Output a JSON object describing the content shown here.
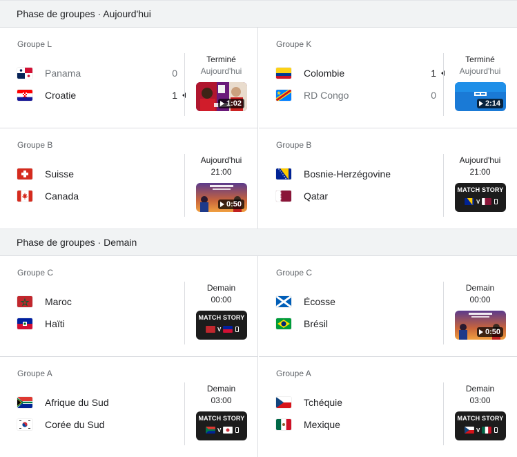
{
  "sections": [
    {
      "title": "Phase de groupes · Aujourd'hui"
    },
    {
      "title": "Phase de groupes · Demain"
    }
  ],
  "matches": [
    {
      "group": "Groupe L",
      "status_line1": "Terminé",
      "status_line2": "Aujourd'hui",
      "team1": {
        "name": "Panama",
        "flag": "panama-flag",
        "score": "0"
      },
      "team2": {
        "name": "Croatie",
        "flag": "croatia-flag",
        "score": "1"
      },
      "video": {
        "duration": "1:02",
        "type": "highlights"
      }
    },
    {
      "group": "Groupe K",
      "status_line1": "Terminé",
      "status_line2": "Aujourd'hui",
      "team1": {
        "name": "Colombie",
        "flag": "colombia-flag",
        "score": "1"
      },
      "team2": {
        "name": "RD Congo",
        "flag": "dr-congo-flag",
        "score": "0"
      },
      "video": {
        "duration": "2:14",
        "type": "highlights"
      }
    },
    {
      "group": "Groupe B",
      "status_line1": "Aujourd'hui",
      "status_line2": "21:00",
      "team1": {
        "name": "Suisse",
        "flag": "switzerland-flag"
      },
      "team2": {
        "name": "Canada",
        "flag": "canada-flag"
      },
      "video": {
        "duration": "0:50",
        "type": "promo"
      }
    },
    {
      "group": "Groupe B",
      "status_line1": "Aujourd'hui",
      "status_line2": "21:00",
      "team1": {
        "name": "Bosnie-Herzégovine",
        "flag": "bosnia-flag"
      },
      "team2": {
        "name": "Qatar",
        "flag": "qatar-flag"
      },
      "video": {
        "label": "MATCH STORY",
        "type": "match-story"
      }
    },
    {
      "group": "Groupe C",
      "status_line1": "Demain",
      "status_line2": "00:00",
      "team1": {
        "name": "Maroc",
        "flag": "morocco-flag"
      },
      "team2": {
        "name": "Haïti",
        "flag": "haiti-flag"
      },
      "video": {
        "label": "MATCH STORY",
        "type": "match-story"
      }
    },
    {
      "group": "Groupe C",
      "status_line1": "Demain",
      "status_line2": "00:00",
      "team1": {
        "name": "Écosse",
        "flag": "scotland-flag"
      },
      "team2": {
        "name": "Brésil",
        "flag": "brazil-flag"
      },
      "video": {
        "duration": "0:50",
        "type": "promo"
      }
    },
    {
      "group": "Groupe A",
      "status_line1": "Demain",
      "status_line2": "03:00",
      "team1": {
        "name": "Afrique du Sud",
        "flag": "south-africa-flag"
      },
      "team2": {
        "name": "Corée du Sud",
        "flag": "south-korea-flag"
      },
      "video": {
        "label": "MATCH STORY",
        "type": "match-story"
      }
    },
    {
      "group": "Groupe A",
      "status_line1": "Demain",
      "status_line2": "03:00",
      "team1": {
        "name": "Tchéquie",
        "flag": "czechia-flag"
      },
      "team2": {
        "name": "Mexique",
        "flag": "mexico-flag"
      },
      "video": {
        "label": "MATCH STORY",
        "type": "match-story"
      }
    }
  ],
  "colors": {
    "section_bg": "#f1f3f4",
    "divider": "#dadce0",
    "muted_text": "#70757a"
  }
}
